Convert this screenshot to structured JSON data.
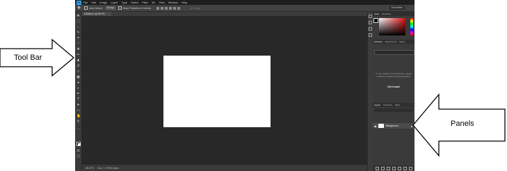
{
  "app": {
    "logo": "Ps",
    "menu": [
      "File",
      "Edit",
      "Image",
      "Layer",
      "Type",
      "Select",
      "Filter",
      "3D",
      "View",
      "Window",
      "Help"
    ]
  },
  "options_bar": {
    "auto_select": "Auto-Select:",
    "group": "Group",
    "show_transform": "Show Transform Controls",
    "mode_3d": "3D Mode:",
    "workspace": "Essentials"
  },
  "document": {
    "tab_label": "Untitled-1 @ 66.7% (RGB/8)",
    "zoom": "66.67%",
    "doc_info": "Doc: 1.37M/0 bytes"
  },
  "panels": {
    "color_tabs": [
      "Color",
      "Swatches"
    ],
    "library_tabs": [
      "Libraries",
      "Adjustments",
      "Styles"
    ],
    "library_message": "To use Creative Cloud Libraries, please install the Creative Cloud Application",
    "library_link": "Get it now!",
    "layers_tabs": [
      "Layers",
      "Channels",
      "Paths"
    ],
    "layer_name": "Background"
  },
  "annotations": {
    "toolbar_label": "Tool Bar",
    "panels_label": "Panels"
  }
}
